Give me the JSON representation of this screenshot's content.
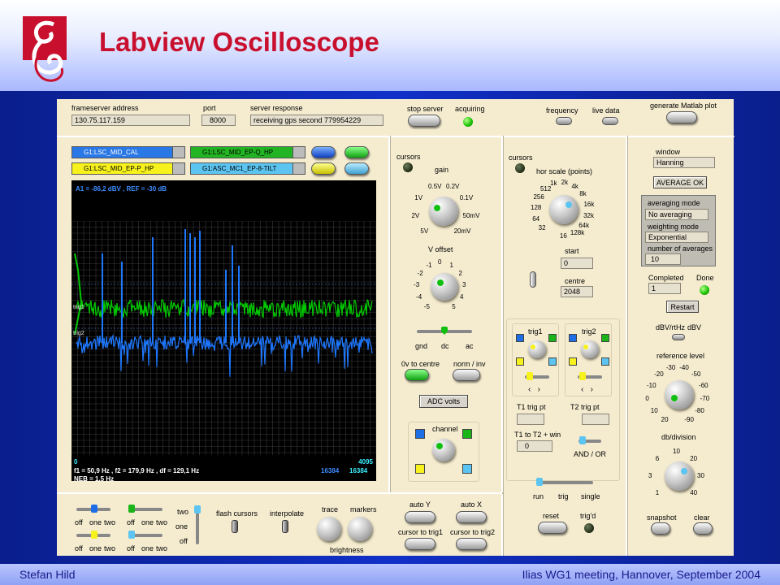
{
  "header": {
    "title": "Labview Oscilloscope"
  },
  "footer": {
    "left": "Stefan Hild",
    "right": "Ilias WG1 meeting, Hannover, September 2004"
  },
  "top": {
    "frameserver_label": "frameserver address",
    "frameserver_value": "130.75.117.159",
    "port_label": "port",
    "port_value": "8000",
    "server_response_label": "server response",
    "server_response_value": "receiving gps second  779954229",
    "stop_server": "stop server",
    "acquiring": "acquiring",
    "frequency": "frequency",
    "live_data": "live data",
    "generate_matlab": "generate Matlab plot"
  },
  "channels": [
    "G1:LSC_MID_CAL",
    "G1:LSC_MID_EP-Q_HP",
    "G1:LSC_MID_EP-P_HP",
    "G1:ASC_MC1_EP-8-TILT"
  ],
  "scope": {
    "header_text": "A1 = -86,2 dBV ,  REF = -30 dB",
    "zero": "0",
    "max": "4095",
    "readout1": "f1 =  50,9 Hz , f2 = 179,9 Hz , df = 129,1 Hz",
    "readout2": "NEB =   1,5 Hz",
    "n1": "16384",
    "n2": "16384",
    "trig1": "trig1",
    "trig2": "trig2"
  },
  "mid": {
    "cursors": "cursors",
    "gain": "gain",
    "gain_scale": [
      "0.5V",
      "0.2V",
      "0.1V",
      "1V",
      "2V",
      "50mV",
      "5V",
      "20mV"
    ],
    "voffset": "V offset",
    "voffset_scale": [
      "-1",
      "0",
      "1",
      "-2",
      "2",
      "-3",
      "3",
      "-4",
      "4",
      "-5",
      "5"
    ],
    "gnd": "gnd",
    "dc": "dc",
    "ac": "ac",
    "ov_centre": "0v to centre",
    "norm_inv": "norm / inv",
    "adc_volts": "ADC volts",
    "channel": "channel"
  },
  "hor": {
    "cursors": "cursors",
    "scale_label": "hor scale (points)",
    "scale": [
      "512",
      "1k",
      "2k",
      "4k",
      "256",
      "8k",
      "128",
      "16k",
      "64",
      "32k",
      "32",
      "16",
      "128k",
      "64k"
    ],
    "start": "start",
    "start_value": "0",
    "centre": "centre",
    "centre_value": "2048",
    "trig1": "trig1",
    "trig2": "trig2",
    "t1_trig_pt": "T1 trig pt",
    "t2_trig_pt": "T2 trig pt",
    "t1_t2_win": "T1 to T2 + win",
    "t1_t2_value": "0",
    "and_or": "AND / OR",
    "run": "run",
    "trig": "trig",
    "single": "single",
    "reset": "reset",
    "trigd": "trig'd"
  },
  "right": {
    "window": "window",
    "window_value": "Hanning",
    "average_ok": "AVERAGE OK",
    "averaging_mode": "averaging mode",
    "averaging_value": "No averaging",
    "weighting_mode": "weighting mode",
    "weighting_value": "Exponential",
    "num_averages": "number of averages",
    "num_averages_value": "10",
    "completed": "Completed",
    "completed_value": "1",
    "done": "Done",
    "restart": "Restart",
    "dbv_rthz": "dBV/rtHz",
    "dbv": "dBV",
    "ref_level": "reference level",
    "ref_scale": [
      "-30",
      "-40",
      "-20",
      "-50",
      "-10",
      "-60",
      "0",
      "-70",
      "10",
      "-80",
      "20",
      "-90"
    ],
    "db_division": "db/division",
    "db_scale": [
      "10",
      "6",
      "20",
      "3",
      "30",
      "1",
      "40"
    ],
    "snapshot": "snapshot",
    "clear": "clear"
  },
  "bottom": {
    "off": "off",
    "one": "one",
    "two": "two",
    "flash_cursors": "flash cursors",
    "interpolate": "interpolate",
    "trace": "trace",
    "markers": "markers",
    "brightness": "brightness",
    "auto_y": "auto Y",
    "auto_x": "auto X",
    "cursor_trig1": "cursor to trig1",
    "cursor_trig2": "cursor to trig2"
  },
  "colors": {
    "accent_title": "#c8102e",
    "scope_green": "#00cc00",
    "scope_blue": "#1e78ff"
  }
}
